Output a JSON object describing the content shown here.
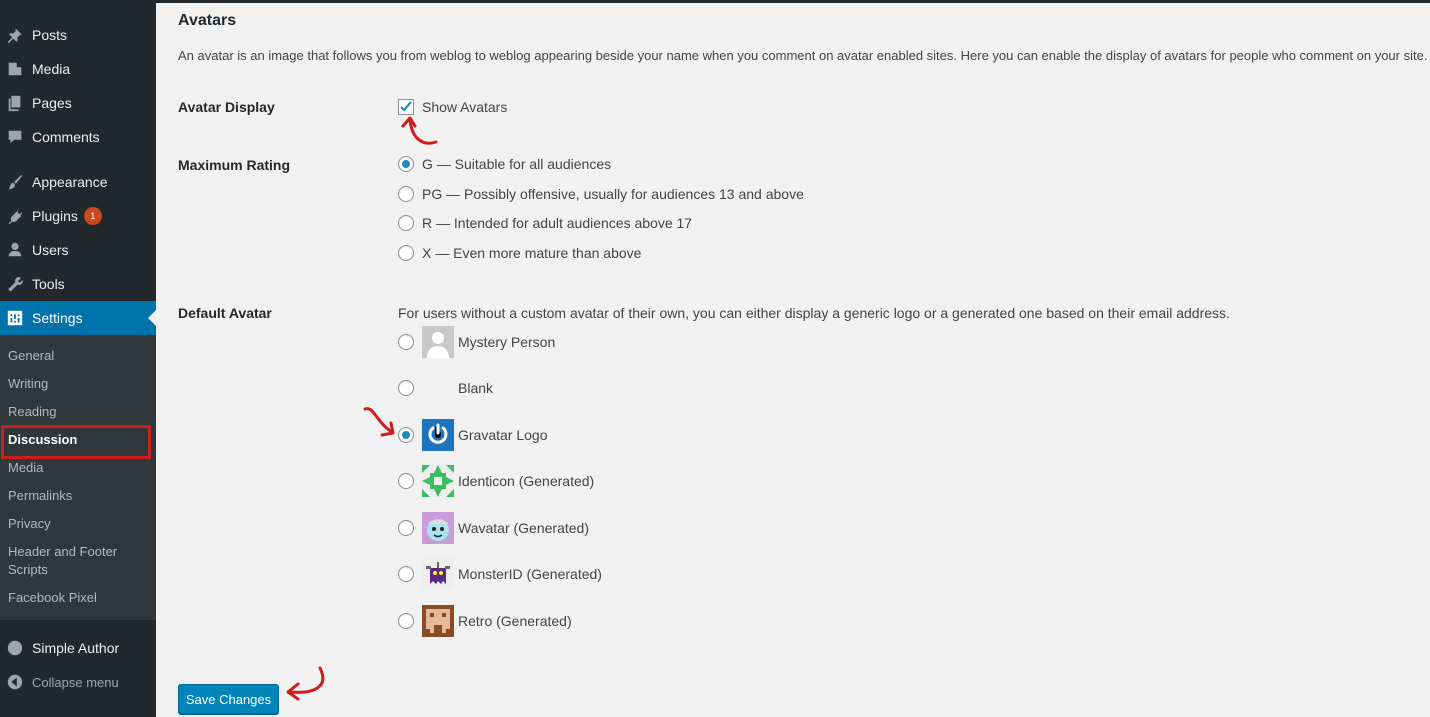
{
  "sidebar": {
    "menu": [
      {
        "label": "Posts",
        "icon": "pin-icon"
      },
      {
        "label": "Media",
        "icon": "media-icon"
      },
      {
        "label": "Pages",
        "icon": "pages-icon"
      },
      {
        "label": "Comments",
        "icon": "comment-icon"
      },
      {
        "label": "Appearance",
        "icon": "paintbrush-icon"
      },
      {
        "label": "Plugins",
        "icon": "plug-icon",
        "badge": "1"
      },
      {
        "label": "Users",
        "icon": "user-icon"
      },
      {
        "label": "Tools",
        "icon": "wrench-icon"
      },
      {
        "label": "Settings",
        "icon": "settings-icon",
        "current": true
      }
    ],
    "submenu": [
      "General",
      "Writing",
      "Reading",
      "Discussion",
      "Media",
      "Permalinks",
      "Privacy",
      "Header and Footer Scripts",
      "Facebook Pixel"
    ],
    "submenu_current": "Discussion",
    "extra": {
      "label": "Simple Author",
      "icon": "simple-author-icon"
    },
    "collapse": {
      "label": "Collapse menu",
      "icon": "collapse-icon"
    }
  },
  "section": {
    "title": "Avatars",
    "description": "An avatar is an image that follows you from weblog to weblog appearing beside your name when you comment on avatar enabled sites. Here you can enable the display of avatars for people who comment on your site."
  },
  "avatar_display": {
    "label": "Avatar Display",
    "checkbox_label": "Show Avatars",
    "checked": true
  },
  "maximum_rating": {
    "label": "Maximum Rating",
    "options": [
      "G — Suitable for all audiences",
      "PG — Possibly offensive, usually for audiences 13 and above",
      "R — Intended for adult audiences above 17",
      "X — Even more mature than above"
    ],
    "selected": "G — Suitable for all audiences"
  },
  "default_avatar": {
    "label": "Default Avatar",
    "description": "For users without a custom avatar of their own, you can either display a generic logo or a generated one based on their email address.",
    "options": [
      "Mystery Person",
      "Blank",
      "Gravatar Logo",
      "Identicon (Generated)",
      "Wavatar (Generated)",
      "MonsterID (Generated)",
      "Retro (Generated)"
    ],
    "selected": "Gravatar Logo"
  },
  "save_button": "Save Changes",
  "colors": {
    "sidebar_bg": "#23282d",
    "submenu_bg": "#32373c",
    "accent": "#0073aa",
    "button": "#0085ba",
    "annotation": "#d11c1c"
  }
}
